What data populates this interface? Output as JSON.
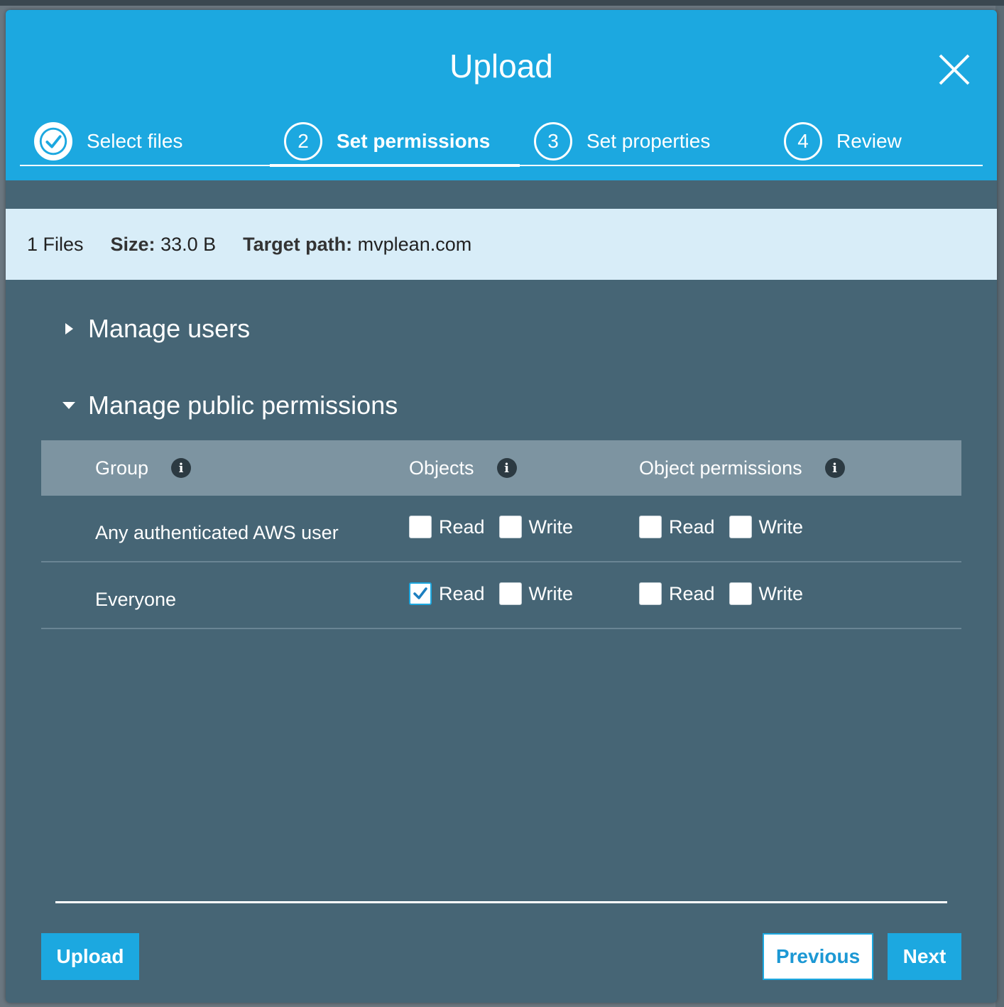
{
  "modal": {
    "title": "Upload"
  },
  "steps": [
    {
      "number": "",
      "label": "Select files",
      "state": "done"
    },
    {
      "number": "2",
      "label": "Set permissions",
      "state": "active"
    },
    {
      "number": "3",
      "label": "Set properties",
      "state": "pending"
    },
    {
      "number": "4",
      "label": "Review",
      "state": "pending"
    }
  ],
  "summary": {
    "files": "1 Files",
    "size_label": "Size:",
    "size_value": "33.0 B",
    "target_label": "Target path:",
    "target_value": "mvplean.com"
  },
  "sections": {
    "manage_users": "Manage users",
    "manage_public": "Manage public permissions"
  },
  "table": {
    "headers": {
      "group": "Group",
      "objects": "Objects",
      "object_permissions": "Object permissions"
    },
    "rows": [
      {
        "group": "Any authenticated AWS user",
        "objects_read_label": "Read",
        "objects_read": false,
        "objects_write_label": "Write",
        "objects_write": false,
        "perm_read_label": "Read",
        "perm_read": false,
        "perm_write_label": "Write",
        "perm_write": false
      },
      {
        "group": "Everyone",
        "objects_read_label": "Read",
        "objects_read": true,
        "objects_write_label": "Write",
        "objects_write": false,
        "perm_read_label": "Read",
        "perm_read": false,
        "perm_write_label": "Write",
        "perm_write": false
      }
    ]
  },
  "footer": {
    "upload_label": "Upload",
    "previous_label": "Previous",
    "next_label": "Next"
  },
  "colors": {
    "header": "#1ca8e0",
    "body": "#466575",
    "summary": "#d8edf8",
    "table_header": "#7d94a1"
  }
}
